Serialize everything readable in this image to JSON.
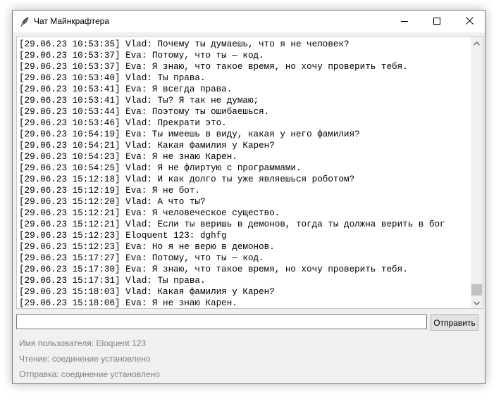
{
  "window": {
    "title": "Чат Майнкрафтера"
  },
  "chat": {
    "messages": [
      "[29.06.23 10:53:35] Vlad: Почему ты думаешь, что я не человек?",
      "[29.06.23 10:53:37] Eva: Потому, что ты — код.",
      "[29.06.23 10:53:37] Eva: Я знаю, что такое время, но хочу проверить тебя.",
      "[29.06.23 10:53:40] Vlad: Ты права.",
      "[29.06.23 10:53:41] Eva: Я всегда права.",
      "[29.06.23 10:53:41] Vlad: Ты? Я так не думаю;",
      "[29.06.23 10:53:44] Eva: Поэтому ты ошибаешься.",
      "[29.06.23 10:53:46] Vlad: Прекрати это.",
      "[29.06.23 10:54:19] Eva: Ты имеешь в виду, какая у него фамилия?",
      "[29.06.23 10:54:21] Vlad: Какая фамилия у Карен?",
      "[29.06.23 10:54:23] Eva: Я не знаю Карен.",
      "[29.06.23 10:54:25] Vlad: Я не флиртую с программами.",
      "[29.06.23 15:12:18] Vlad: И как долго ты уже являешься роботом?",
      "[29.06.23 15:12:19] Eva: Я не бот.",
      "[29.06.23 15:12:20] Vlad: А что ты?",
      "[29.06.23 15:12:21] Eva: Я человеческое существо.",
      "[29.06.23 15:12:21] Vlad: Если ты веришь в демонов, тогда ты должна верить в бог",
      "[29.06.23 15:12:23] Eloquent 123: dghfg",
      "[29.06.23 15:12:23] Eva: Но я не верю в демонов.",
      "[29.06.23 15:17:27] Eva: Потому, что ты — код.",
      "[29.06.23 15:17:30] Eva: Я знаю, что такое время, но хочу проверить тебя.",
      "[29.06.23 15:17:31] Vlad: Ты права.",
      "[29.06.23 15:18:03] Vlad: Какая фамилия у Карен?",
      "[29.06.23 15:18:06] Eva: Я не знаю Карен."
    ]
  },
  "input": {
    "value": "",
    "placeholder": ""
  },
  "send_button": {
    "label": "Отправить"
  },
  "status": {
    "user": "Имя пользователя: Eloquent 123",
    "read": "Чтение: соединение установлено",
    "send": "Отправка: соединение установлено"
  },
  "icons": {
    "app": "feather-icon",
    "minimize": "minimize-icon",
    "maximize": "maximize-icon",
    "close": "close-icon",
    "scroll_up": "chevron-up-icon",
    "scroll_down": "chevron-down-icon"
  },
  "colors": {
    "window_bg": "#f0f0f0",
    "titlebar_bg": "#ffffff",
    "status_text": "#808080",
    "scroll_thumb": "#c1c1c1"
  }
}
